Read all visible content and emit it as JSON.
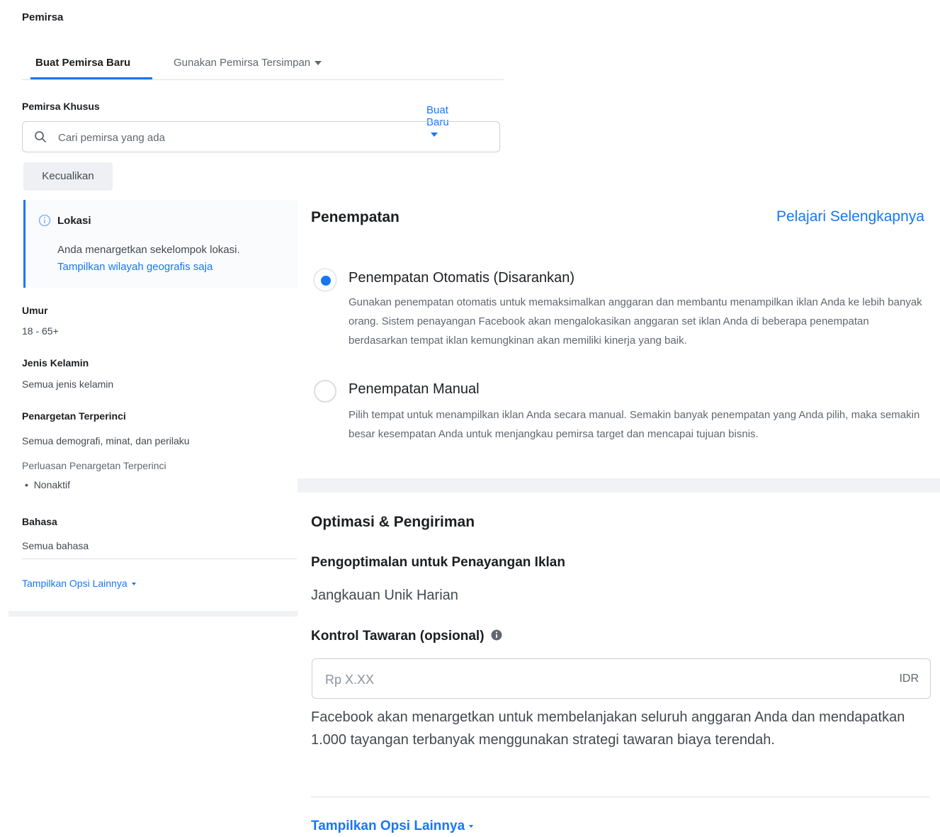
{
  "audience": {
    "section_title": "Pemirsa",
    "tabs": [
      {
        "label": "Buat Pemirsa Baru",
        "active": true
      },
      {
        "label": "Gunakan Pemirsa Tersimpan",
        "active": false
      }
    ],
    "custom_audience": {
      "label": "Pemirsa Khusus",
      "create_new_label": "Buat Baru",
      "search_placeholder": "Cari pemirsa yang ada"
    },
    "exclude_button": "Kecualikan",
    "location": {
      "title": "Lokasi",
      "description": "Anda menargetkan sekelompok lokasi.",
      "link": "Tampilkan wilayah geografis saja"
    },
    "age": {
      "label": "Umur",
      "value": "18 - 65+"
    },
    "gender": {
      "label": "Jenis Kelamin",
      "value": "Semua jenis kelamin"
    },
    "detailed_targeting": {
      "label": "Penargetan Terperinci",
      "value": "Semua demografi, minat, dan perilaku",
      "expansion_label": "Perluasan Penargetan Terperinci",
      "expansion_value": "Nonaktif"
    },
    "language": {
      "label": "Bahasa",
      "value": "Semua bahasa"
    },
    "show_more": "Tampilkan Opsi Lainnya"
  },
  "placement": {
    "title": "Penempatan",
    "learn_more": "Pelajari Selengkapnya",
    "options": [
      {
        "title": "Penempatan Otomatis (Disarankan)",
        "selected": true,
        "description": "Gunakan penempatan otomatis untuk memaksimalkan anggaran dan membantu menampilkan iklan Anda ke lebih banyak orang. Sistem penayangan Facebook akan mengalokasikan anggaran set iklan Anda di beberapa penempatan berdasarkan tempat iklan kemungkinan akan memiliki kinerja yang baik."
      },
      {
        "title": "Penempatan Manual",
        "selected": false,
        "description": "Pilih tempat untuk menampilkan iklan Anda secara manual. Semakin banyak penempatan yang Anda pilih, maka semakin besar kesempatan Anda untuk menjangkau pemirsa target dan mencapai tujuan bisnis."
      }
    ]
  },
  "optimization": {
    "title": "Optimasi & Pengiriman",
    "ad_delivery_label": "Pengoptimalan untuk Penayangan Iklan",
    "ad_delivery_value": "Jangkauan Unik Harian",
    "bid_control_label": "Kontrol Tawaran (opsional)",
    "bid_placeholder": "Rp X.XX",
    "currency": "IDR",
    "description": "Facebook akan menargetkan untuk membelanjakan seluruh anggaran Anda dan mendapatkan 1.000 tayangan terbanyak menggunakan strategi tawaran biaya terendah.",
    "show_more": "Tampilkan Opsi Lainnya"
  },
  "colors": {
    "accent": "#1877f2",
    "text": "#1c1e21",
    "muted": "#606770",
    "band": "#f0f2f5"
  }
}
